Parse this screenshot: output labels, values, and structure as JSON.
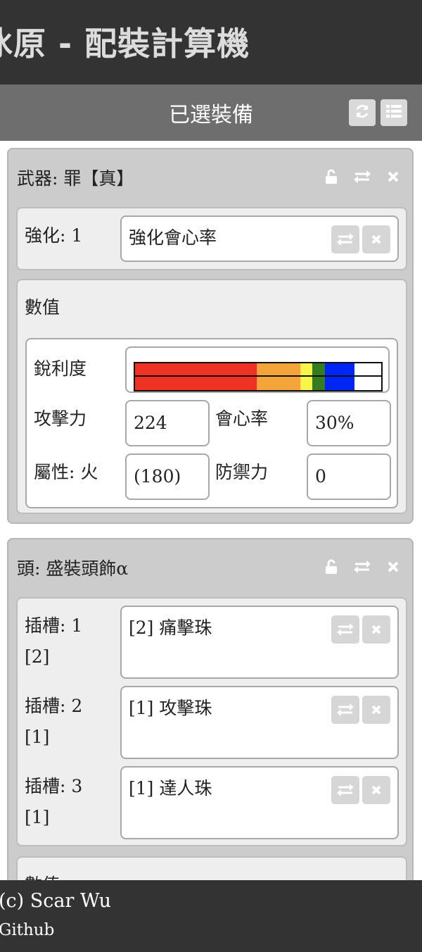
{
  "header": {
    "title": "冰原 - 配裝計算機"
  },
  "subheader": {
    "title": "已選裝備",
    "refresh_icon": "refresh-icon",
    "list_icon": "list-icon"
  },
  "weapon": {
    "title": "武器: 罪【真】",
    "enhance": {
      "label": "強化: 1",
      "value": "強化會心率"
    },
    "stats": {
      "title": "數值",
      "sharpness_label": "銳利度",
      "sharpness_colors": [
        "#ee3324",
        "#f3a53a",
        "#f7f548",
        "#357b20",
        "#0026f5",
        "#ffffff"
      ],
      "sharpness_fractions": [
        0.495,
        0.175,
        0.05,
        0.05,
        0.12,
        0.11
      ],
      "attack_label": "攻擊力",
      "attack_value": "224",
      "affinity_label": "會心率",
      "affinity_value": "30%",
      "element_label": "屬性: 火",
      "element_value": "(180)",
      "defense_label": "防禦力",
      "defense_value": "0"
    }
  },
  "head": {
    "title": "頭: 盛裝頭飾α",
    "slots": [
      {
        "label": "插槽: 1",
        "size": "[2]",
        "value": "[2] 痛擊珠"
      },
      {
        "label": "插槽: 2",
        "size": "[1]",
        "value": "[1] 攻擊珠"
      },
      {
        "label": "插槽: 3",
        "size": "[1]",
        "value": "[1] 達人珠"
      }
    ],
    "stats_title": "數值"
  },
  "footer": {
    "copyright": "(c) Scar Wu",
    "link": "Github"
  }
}
